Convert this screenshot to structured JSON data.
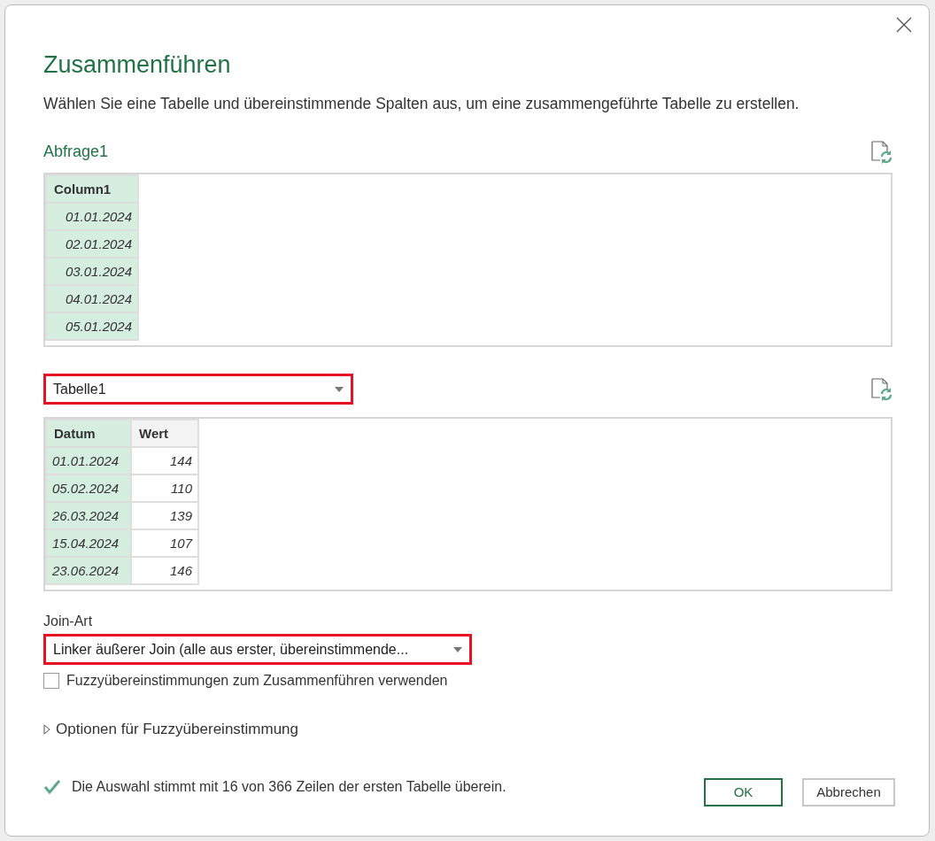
{
  "dialog": {
    "title": "Zusammenführen",
    "description": "Wählen Sie eine Tabelle und übereinstimmende Spalten aus, um eine zusammengeführte Tabelle zu erstellen."
  },
  "first_table": {
    "name": "Abfrage1",
    "columns": [
      {
        "label": "Column1",
        "selected": true
      }
    ],
    "rows": [
      [
        "01.01.2024"
      ],
      [
        "02.01.2024"
      ],
      [
        "03.01.2024"
      ],
      [
        "04.01.2024"
      ],
      [
        "05.01.2024"
      ]
    ]
  },
  "second_table": {
    "dropdown": {
      "value": "Tabelle1",
      "highlighted": true
    },
    "columns": [
      {
        "label": "Datum",
        "selected": true
      },
      {
        "label": "Wert",
        "selected": false
      }
    ],
    "rows": [
      [
        "01.01.2024",
        "144"
      ],
      [
        "05.02.2024",
        "110"
      ],
      [
        "26.03.2024",
        "139"
      ],
      [
        "15.04.2024",
        "107"
      ],
      [
        "23.06.2024",
        "146"
      ]
    ]
  },
  "join_kind": {
    "label": "Join-Art",
    "value": "Linker äußerer Join (alle aus erster, übereinstimmende...",
    "highlighted": true
  },
  "fuzzy_checkbox": {
    "label": "Fuzzyübereinstimmungen zum Zusammenführen verwenden",
    "checked": false
  },
  "fuzzy_options": {
    "label": "Optionen für Fuzzyübereinstimmung",
    "expanded": false
  },
  "status": {
    "text": "Die Auswahl stimmt mit 16 von 366 Zeilen der ersten Tabelle überein."
  },
  "buttons": [
    {
      "label": "OK",
      "kind": "primary"
    },
    {
      "label": "Abbrechen",
      "kind": "secondary"
    }
  ]
}
